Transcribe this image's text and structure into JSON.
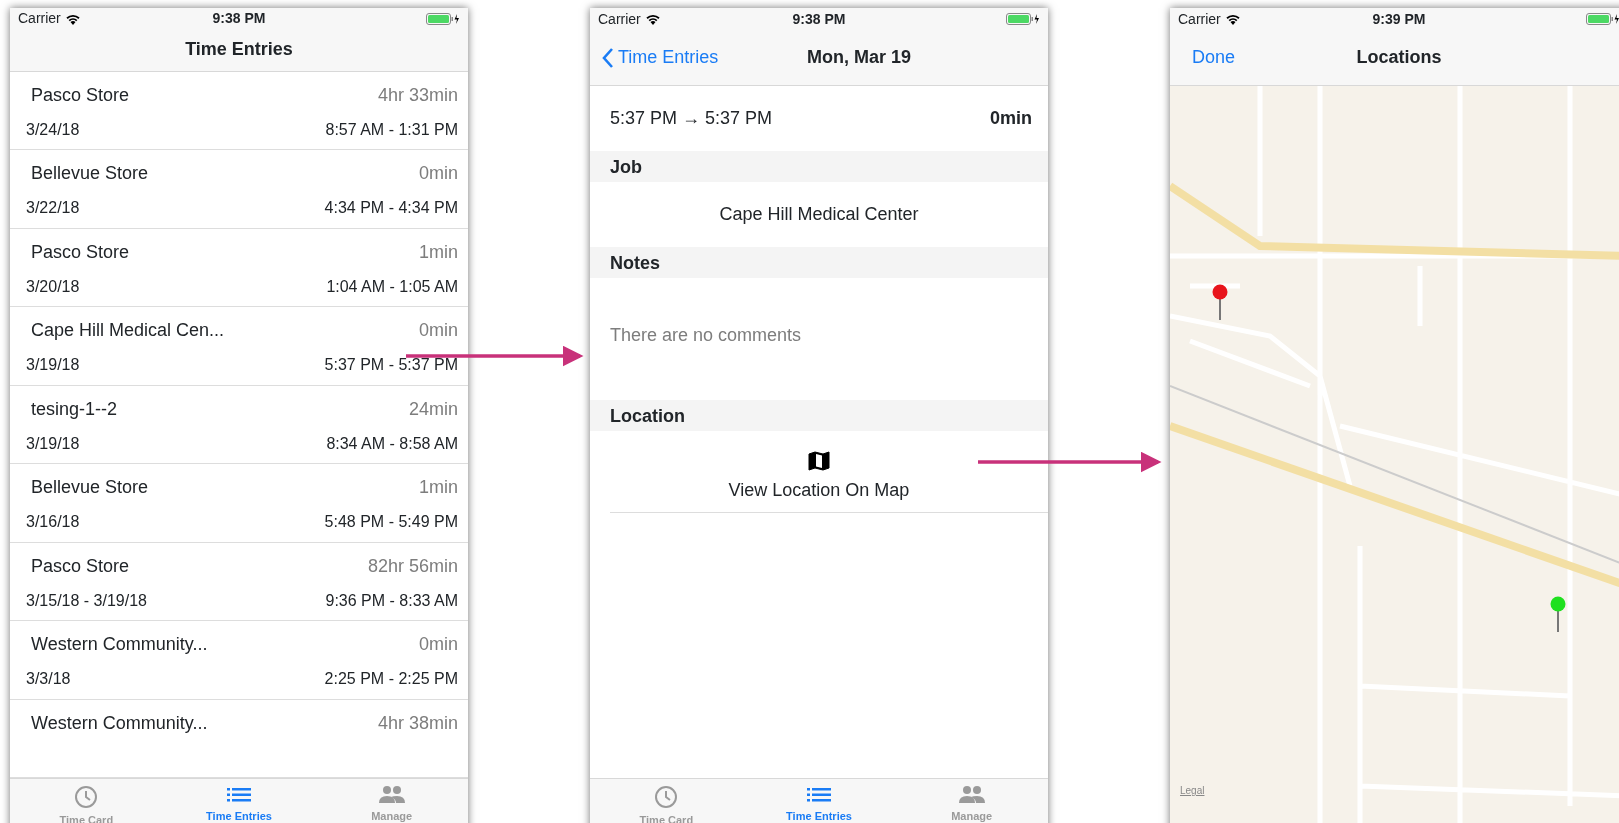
{
  "screens": [
    {
      "kind": "list",
      "status_bar": {
        "carrier": "Carrier",
        "time": "9:38 PM"
      },
      "nav": {
        "title": "Time Entries"
      },
      "entries": [
        {
          "title": "Pasco Store",
          "duration": "4hr 33min",
          "date": "3/24/18",
          "range": "8:57 AM - 1:31 PM"
        },
        {
          "title": "Bellevue Store",
          "duration": "0min",
          "date": "3/22/18",
          "range": "4:34 PM - 4:34 PM"
        },
        {
          "title": "Pasco Store",
          "duration": "1min",
          "date": "3/20/18",
          "range": "1:04 AM - 1:05 AM"
        },
        {
          "title": "Cape Hill Medical Cen...",
          "duration": "0min",
          "date": "3/19/18",
          "range": "5:37 PM - 5:37 PM"
        },
        {
          "title": "tesing-1--2",
          "duration": "24min",
          "date": "3/19/18",
          "range": "8:34 AM - 8:58 AM"
        },
        {
          "title": "Bellevue Store",
          "duration": "1min",
          "date": "3/16/18",
          "range": "5:48 PM - 5:49 PM"
        },
        {
          "title": "Pasco Store",
          "duration": "82hr 56min",
          "date": "3/15/18 - 3/19/18",
          "range": "9:36 PM - 8:33 AM"
        },
        {
          "title": "Western Community...",
          "duration": "0min",
          "date": "3/3/18",
          "range": "2:25 PM - 2:25 PM"
        },
        {
          "title": "Western Community...",
          "duration": "4hr 38min"
        }
      ],
      "tab_bar": [
        {
          "label": "Time Card",
          "selected": false
        },
        {
          "label": "Time Entries",
          "selected": true
        },
        {
          "label": "Manage",
          "selected": false
        }
      ]
    },
    {
      "kind": "detail",
      "status_bar": {
        "carrier": "Carrier",
        "time": "9:38 PM"
      },
      "nav": {
        "back": "Time Entries",
        "title": "Mon, Mar 19"
      },
      "time_range": "5:37 PM → 5:37 PM",
      "duration": "0min",
      "sections": [
        {
          "header": "Job",
          "value": "Cape Hill Medical Center"
        },
        {
          "header": "Notes",
          "placeholder": "There are no comments"
        },
        {
          "header": "Location",
          "action": "View Location On Map"
        }
      ],
      "tab_bar": [
        {
          "label": "Time Card",
          "selected": false
        },
        {
          "label": "Time Entries",
          "selected": true
        },
        {
          "label": "Manage",
          "selected": false
        }
      ]
    },
    {
      "kind": "map",
      "status_bar": {
        "carrier": "Carrier",
        "time": "9:39 PM"
      },
      "nav": {
        "left": "Done",
        "title": "Locations"
      },
      "pins": [
        {
          "color": "#e8141b"
        },
        {
          "color": "#1fe01f"
        }
      ],
      "legal": "Legal"
    }
  ]
}
